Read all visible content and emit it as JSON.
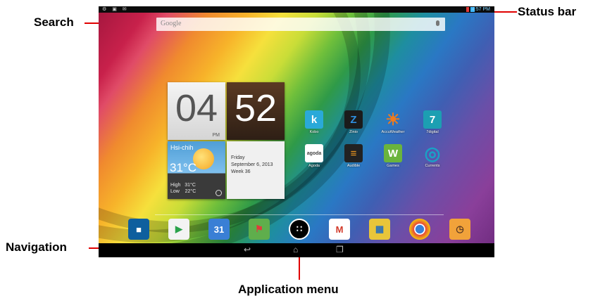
{
  "annotations": {
    "search": "Search",
    "status_bar": "Status bar",
    "navigation": "Navigation",
    "application_menu": "Application menu"
  },
  "colors": {
    "arrow": "#e00000"
  },
  "status_bar": {
    "time": "4:57 PM",
    "left_icons": "⚙ ▣ ✉"
  },
  "search": {
    "placeholder": "Google",
    "mic_icon": "microphone-icon"
  },
  "clock_widget": {
    "hour": "04",
    "minute": "52",
    "ampm": "PM",
    "city": "Hsi-chih",
    "temperature": "31°C",
    "high_label": "High",
    "high_value": "31°C",
    "low_label": "Low",
    "low_value": "22°C",
    "day": "Friday",
    "date": "September 6, 2013",
    "week": "Week 36"
  },
  "apps": [
    {
      "label": "Kobo",
      "glyph": "k",
      "color": "#2aa9d9"
    },
    {
      "label": "Zinio",
      "glyph": "Z",
      "color": "#1b1b1b"
    },
    {
      "label": "AccuWeather",
      "glyph": "☀",
      "color": "#f07b1c"
    },
    {
      "label": "7digital",
      "glyph": "7",
      "color": "#1c9fb2"
    },
    {
      "label": "Agoda",
      "glyph": "agoda",
      "color": "#ffffff"
    },
    {
      "label": "Audible",
      "glyph": "≡",
      "color": "#222222"
    },
    {
      "label": "Games",
      "glyph": "W",
      "color": "#6ab43c"
    },
    {
      "label": "Currents",
      "glyph": "◎",
      "color": "#1aa1c6"
    }
  ],
  "dock": [
    {
      "name": "dolby-icon",
      "glyph": "■",
      "bg": "#0e5f9e"
    },
    {
      "name": "play-store-icon",
      "glyph": "▶",
      "bg": "#f3f3f3"
    },
    {
      "name": "calendar-icon",
      "glyph": "31",
      "bg": "#3a7fd5"
    },
    {
      "name": "maps-icon",
      "glyph": "⚑",
      "bg": "#5fae4c"
    },
    {
      "name": "app-drawer-icon",
      "glyph": "∷",
      "bg": "#000000"
    },
    {
      "name": "gmail-icon",
      "glyph": "M",
      "bg": "#ffffff"
    },
    {
      "name": "app-grid-icon",
      "glyph": "▦",
      "bg": "#e8c53a"
    },
    {
      "name": "chrome-icon",
      "glyph": "◉",
      "bg": "#e8443a"
    },
    {
      "name": "clock-app-icon",
      "glyph": "◷",
      "bg": "#f1a23a"
    }
  ],
  "navbar": {
    "back": "↩",
    "home": "⌂",
    "recents": "❐"
  }
}
